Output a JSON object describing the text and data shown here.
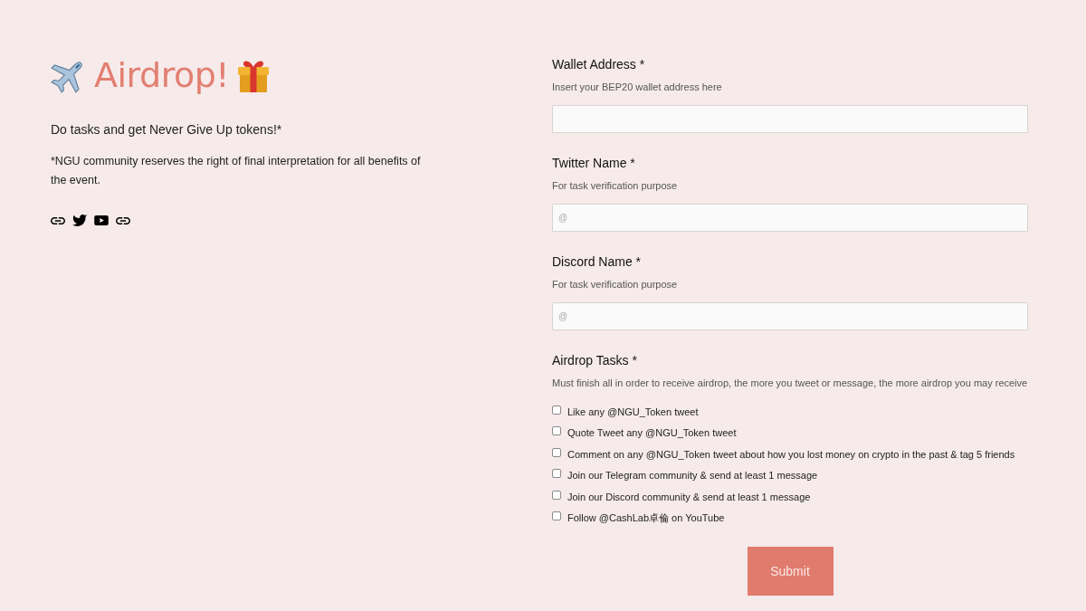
{
  "header": {
    "title": "Airdrop!",
    "tagline": "Do tasks and get Never Give Up tokens!*",
    "disclaimer": "*NGU community reserves the right of final interpretation for all benefits of the event."
  },
  "social_links": [
    {
      "kind": "link"
    },
    {
      "kind": "bird"
    },
    {
      "kind": "video"
    },
    {
      "kind": "link"
    }
  ],
  "form": {
    "fields": [
      {
        "label": "Wallet Address *",
        "hint": "Insert your BEP20 wallet address here"
      },
      {
        "label": "Twitter Name *",
        "hint": "For task verification purpose",
        "placeholder": "@"
      },
      {
        "label": "Discord Name *",
        "hint": "For task verification purpose",
        "placeholder": "@"
      }
    ],
    "tasks": {
      "label": "Airdrop Tasks *",
      "hint": "Must finish all in order to receive airdrop, the more you tweet or message, the more airdrop you may receive",
      "items": [
        {
          "label": "Like any @NGU_Token tweet",
          "checked": false
        },
        {
          "label": "Quote Tweet any @NGU_Token tweet",
          "checked": false
        },
        {
          "label": "Comment on any @NGU_Token tweet about how you lost money on crypto in the past & tag 5 friends",
          "checked": false
        },
        {
          "label": "Join our Telegram community & send at least 1 message",
          "checked": false
        },
        {
          "label": "Join our Discord community & send at least 1 message",
          "checked": false
        },
        {
          "label": "Follow @CashLab卓倫 on YouTube",
          "checked": false
        }
      ]
    },
    "submit": {
      "label": "Submit"
    }
  }
}
